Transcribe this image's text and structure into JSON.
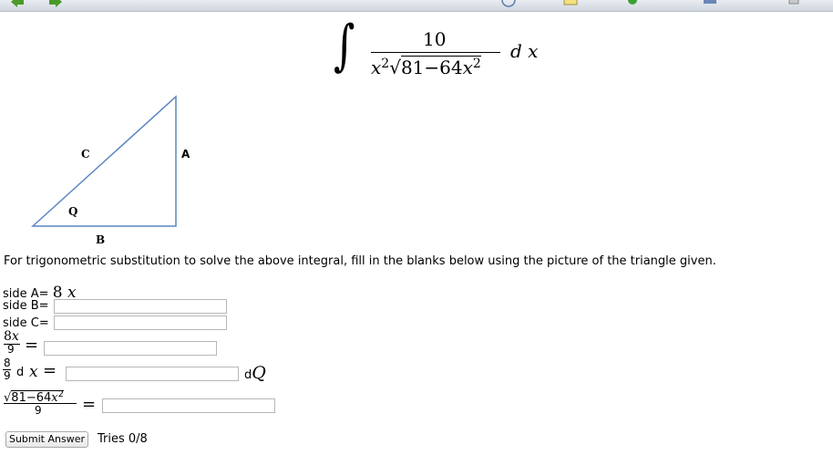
{
  "problem": {
    "integral_sign": "∫",
    "numerator": "10",
    "denominator_var": "x",
    "denominator_exp": "2",
    "radical_sign": "√",
    "radicand": "81−64",
    "radicand_var": "x",
    "radicand_exp": "2",
    "differential": "d x"
  },
  "triangle": {
    "label_hypotenuse": "C",
    "label_vertical": "A",
    "label_angle": "Q",
    "label_base": "B"
  },
  "instructions": "For trigonometric substitution to solve the above integral, fill in the blanks below using the picture of the triangle given.",
  "form": {
    "side_a_label": "side A=",
    "side_a_value": "8",
    "side_a_var": "x",
    "side_b_label": "side B=",
    "side_b_value": "",
    "side_c_label": "side C=",
    "side_c_value": "",
    "row4_num": "8",
    "row4_num_var": "x",
    "row4_den": "9",
    "row4_eq": "=",
    "row4_value": "",
    "row5_num": "8",
    "row5_den": "9",
    "row5_d": "d",
    "row5_var": "x",
    "row5_eq": "=",
    "row5_value": "",
    "row5_suffix_d": "d",
    "row5_suffix_var": "Q",
    "row6_radical": "√",
    "row6_radicand": "81−64",
    "row6_var": "x",
    "row6_exp": "2",
    "row6_den": "9",
    "row6_eq": "=",
    "row6_value": ""
  },
  "footer": {
    "submit_label": "Submit Answer",
    "tries_text": "Tries 0/8"
  }
}
